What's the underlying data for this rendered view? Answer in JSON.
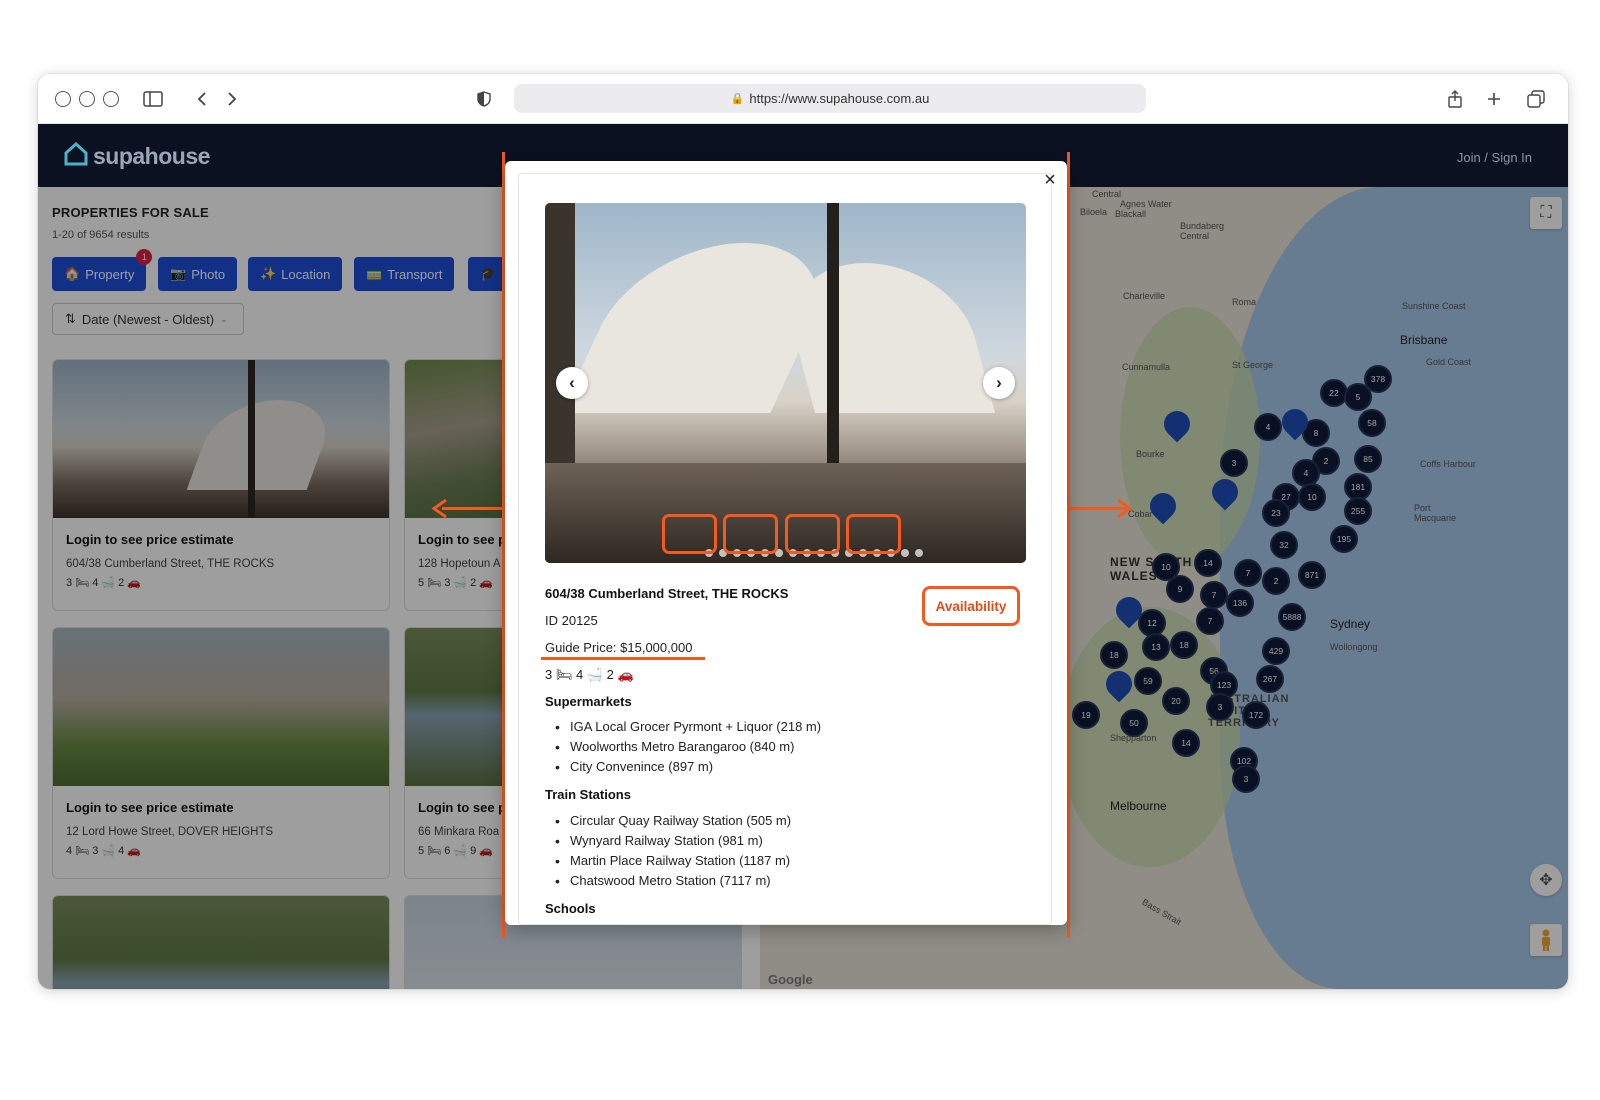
{
  "browser": {
    "url": "https://www.supahouse.com.au"
  },
  "header": {
    "logo_text": "supahouse",
    "join_label": "Join / Sign In"
  },
  "listing": {
    "title": "PROPERTIES FOR SALE",
    "count": "1-20 of 9654 results",
    "filters": [
      {
        "label": "Property",
        "icon": "🏠",
        "badge": "1"
      },
      {
        "label": "Photo",
        "icon": "📷"
      },
      {
        "label": "Location",
        "icon": "✨"
      },
      {
        "label": "Transport",
        "icon": "🚃"
      },
      {
        "label": "",
        "icon": "🎓"
      }
    ],
    "sort_label": "Date (Newest - Oldest)",
    "cards": [
      {
        "title": "Login to see price estimate",
        "address": "604/38 Cumberland Street, THE ROCKS",
        "features": "3 🛏  4 🛁  2 🚗"
      },
      {
        "title": "Login to see p",
        "address": "128 Hopetoun A",
        "features": "5 🛏  3 🛁  2 🚗"
      },
      {
        "title": "Login to see price estimate",
        "address": "12 Lord Howe Street, DOVER HEIGHTS",
        "features": "4 🛏  3 🛁  4 🚗"
      },
      {
        "title": "Login to see p",
        "address": "66 Minkara Roa",
        "features": "5 🛏  6 🛁  9 🚗"
      }
    ]
  },
  "map": {
    "labels": {
      "central": "Central",
      "agnes_water": "Agnes Water",
      "blackall": "Blackall",
      "biloela": "Biloela",
      "bundaberg": "Bundaberg Central",
      "charleville": "Charleville",
      "roma": "Roma",
      "sunshine_coast": "Sunshine Coast",
      "brisbane": "Brisbane",
      "gold_coast": "Gold Coast",
      "cunnamulla": "Cunnamulla",
      "st_george": "St George",
      "bourke": "Bourke",
      "coffs": "Coffs Harbour",
      "port_macquarie": "Port Macquarie",
      "cobar": "Cobar",
      "nsw": "NEW SOUTH WALES",
      "sydney": "Sydney",
      "wollongong": "Wollongong",
      "act": "AUSTRALIAN CAPITAL TERRITORY",
      "shepparton": "Shepparton",
      "melbourne": "Melbourne",
      "bass_strait": "Bass Strait"
    },
    "clusters": [
      "378",
      "22",
      "5",
      "58",
      "4",
      "8",
      "85",
      "2",
      "181",
      "3",
      "4",
      "10",
      "27",
      "255",
      "23",
      "195",
      "32",
      "14",
      "871",
      "10",
      "7",
      "2",
      "9",
      "7",
      "136",
      "7",
      "5888",
      "12",
      "18",
      "13",
      "429",
      "18",
      "56",
      "267",
      "59",
      "123",
      "20",
      "3",
      "172",
      "19",
      "50",
      "14",
      "102",
      "3"
    ],
    "attribution": "Google"
  },
  "modal": {
    "close_icon": "×",
    "prev_icon": "‹",
    "next_icon": "›",
    "address": "604/38 Cumberland Street, THE ROCKS",
    "id_text": "ID 20125",
    "price_text": "Guide Price: $15,000,000",
    "features_text": "3 🛏   4 🛁   2 🚗",
    "availability_label": "Availability",
    "sections": {
      "supermarkets": {
        "title": "Supermarkets",
        "items": [
          "IGA Local Grocer Pyrmont + Liquor (218 m)",
          "Woolworths Metro Barangaroo (840 m)",
          "City Convenince (897 m)"
        ]
      },
      "trains": {
        "title": "Train Stations",
        "items": [
          "Circular Quay Railway Station (505 m)",
          "Wynyard Railway Station (981 m)",
          "Martin Place Railway Station (1187 m)",
          "Chatswood Metro Station (7117 m)"
        ]
      },
      "schools": {
        "title": "Schools"
      }
    }
  },
  "colors": {
    "accent": "#f25a1f",
    "brand_dark": "#0b1120",
    "filter_blue": "#1d4ed8",
    "cluster": "#0f1a3a",
    "pin": "#1f4fb8"
  }
}
